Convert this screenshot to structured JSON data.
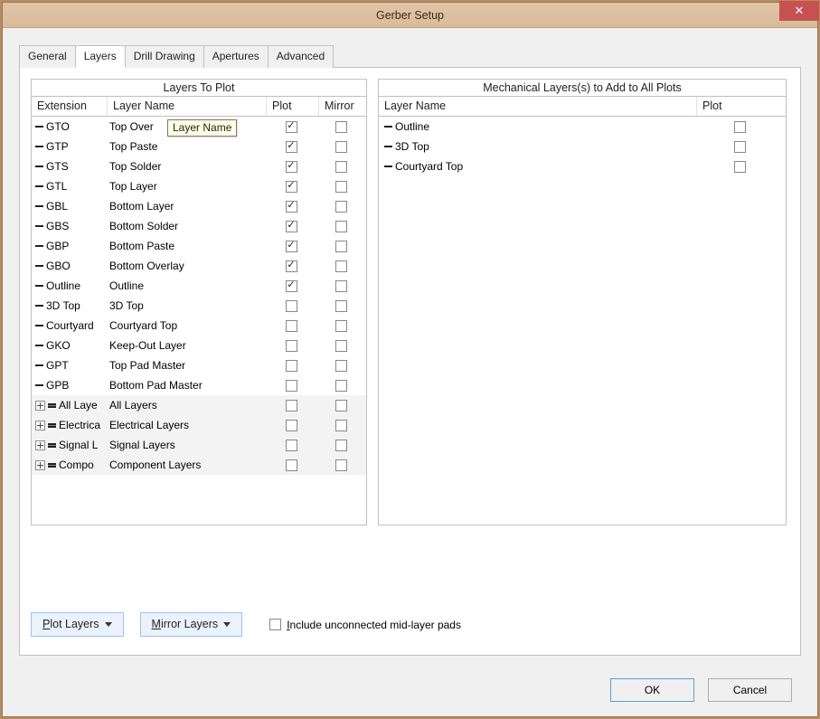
{
  "window_title": "Gerber Setup",
  "close_label": "✕",
  "tabs": [
    "General",
    "Layers",
    "Drill Drawing",
    "Apertures",
    "Advanced"
  ],
  "active_tab_index": 1,
  "left": {
    "title": "Layers To Plot",
    "headers": {
      "ext": "Extension",
      "name": "Layer Name",
      "plot": "Plot",
      "mirror": "Mirror"
    },
    "tooltip": "Layer Name",
    "rows": [
      {
        "ext": "GTO",
        "name": "Top Overlay",
        "name_display": "Top Over",
        "plot": true,
        "mirror": false
      },
      {
        "ext": "GTP",
        "name": "Top Paste",
        "plot": true,
        "mirror": false
      },
      {
        "ext": "GTS",
        "name": "Top Solder",
        "plot": true,
        "mirror": false
      },
      {
        "ext": "GTL",
        "name": "Top Layer",
        "plot": true,
        "mirror": false
      },
      {
        "ext": "GBL",
        "name": "Bottom Layer",
        "plot": true,
        "mirror": false
      },
      {
        "ext": "GBS",
        "name": "Bottom Solder",
        "plot": true,
        "mirror": false
      },
      {
        "ext": "GBP",
        "name": "Bottom Paste",
        "plot": true,
        "mirror": false
      },
      {
        "ext": "GBO",
        "name": "Bottom Overlay",
        "plot": true,
        "mirror": false
      },
      {
        "ext": "Outline",
        "name": "Outline",
        "plot": true,
        "mirror": false
      },
      {
        "ext": "3D Top",
        "name": "3D Top",
        "plot": false,
        "mirror": false
      },
      {
        "ext": "Courtyard",
        "name": "Courtyard Top",
        "plot": false,
        "mirror": false
      },
      {
        "ext": "GKO",
        "name": "Keep-Out Layer",
        "plot": false,
        "mirror": false
      },
      {
        "ext": "GPT",
        "name": "Top Pad Master",
        "plot": false,
        "mirror": false
      },
      {
        "ext": "GPB",
        "name": "Bottom Pad Master",
        "plot": false,
        "mirror": false
      }
    ],
    "groups": [
      {
        "ext": "All Laye",
        "name": "All Layers"
      },
      {
        "ext": "Electrica",
        "name": "Electrical Layers"
      },
      {
        "ext": "Signal L",
        "name": "Signal Layers"
      },
      {
        "ext": "Compo",
        "name": "Component Layers"
      }
    ]
  },
  "right": {
    "title": "Mechanical Layers(s) to Add to All Plots",
    "headers": {
      "name": "Layer Name",
      "plot": "Plot"
    },
    "rows": [
      {
        "name": "Outline",
        "plot": false
      },
      {
        "name": "3D Top",
        "plot": false
      },
      {
        "name": "Courtyard Top",
        "plot": false
      }
    ]
  },
  "buttons": {
    "plot_layers_pre": "P",
    "plot_layers_rest": "lot Layers",
    "mirror_layers_pre": "M",
    "mirror_layers_rest": "irror Layers",
    "include_pre": "I",
    "include_rest": "nclude unconnected mid-layer pads",
    "ok": "OK",
    "cancel": "Cancel"
  }
}
